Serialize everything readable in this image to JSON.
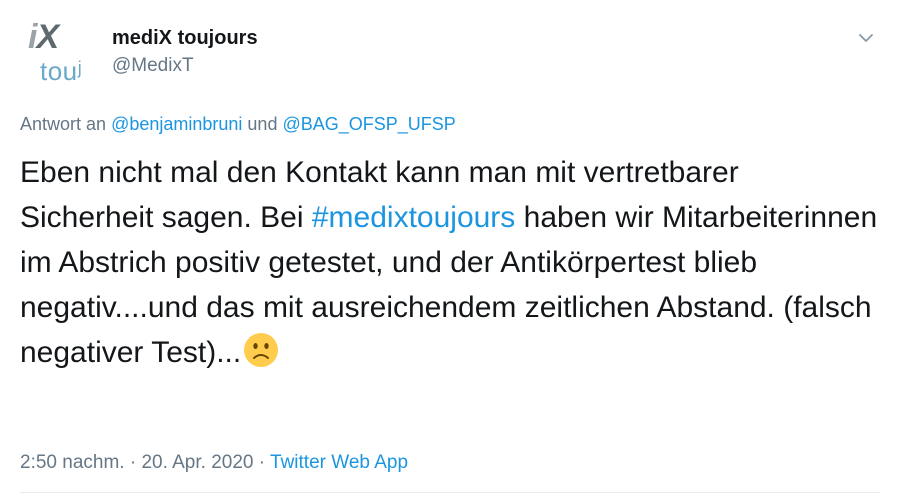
{
  "author": {
    "display_name": "mediX toujours",
    "handle": "@MedixT",
    "avatar_mark_pre": "i",
    "avatar_mark_x": "X",
    "avatar_sub": "touʲ"
  },
  "reply": {
    "prefix": "Antwort an",
    "mention1": "@benjaminbruni",
    "conjunction": "und",
    "mention2": "@BAG_OFSP_UFSP"
  },
  "tweet": {
    "text_part1": "Eben nicht mal den Kontakt kann man mit vertretbarer Sicherheit sagen. Bei",
    "hashtag": "#medixtoujours",
    "text_part2": "haben wir Mitarbeiterinnen im Abstrich positiv getestet, und der Antikörpertest blieb negativ....und das mit ausreichendem zeitlichen Abstand. (falsch negativer Test)...",
    "emoji": "slightly-frowning-face"
  },
  "meta": {
    "time": "2:50 nachm.",
    "separator": "·",
    "date": "20. Apr. 2020",
    "source": "Twitter Web App"
  },
  "icons": {
    "menu": "chevron-down-icon"
  },
  "colors": {
    "link": "#1b95e0",
    "secondary_text": "#657786",
    "primary_text": "#14171a"
  }
}
